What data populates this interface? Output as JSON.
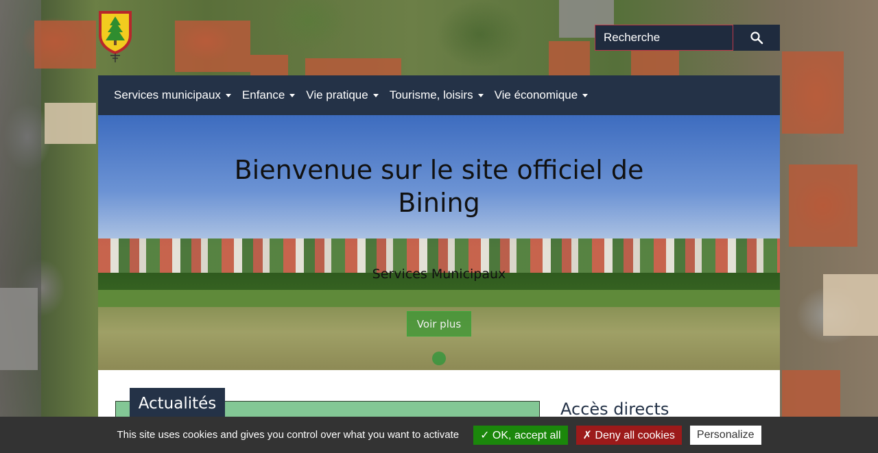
{
  "search": {
    "placeholder": "Recherche",
    "button_icon": "search-icon"
  },
  "nav": {
    "items": [
      {
        "label": "Services municipaux"
      },
      {
        "label": "Enfance"
      },
      {
        "label": "Vie pratique"
      },
      {
        "label": "Tourisme, loisirs"
      },
      {
        "label": "Vie économique"
      }
    ]
  },
  "hero": {
    "title_line1": "Bienvenue sur le site officiel de",
    "title_line2": "Bining",
    "subtitle": "Services Municipaux",
    "button_label": "Voir plus"
  },
  "content": {
    "news_title": "Actualités",
    "access_title": "Accès directs"
  },
  "cookies": {
    "message": "This site uses cookies and gives you control over what you want to activate",
    "accept_label": "✓ OK, accept all",
    "deny_label": "✗ Deny all cookies",
    "personalize_label": "Personalize"
  },
  "colors": {
    "nav_bg": "#243247",
    "accept": "#1b870b",
    "deny": "#9c1a1a",
    "news_box": "#83c795"
  }
}
